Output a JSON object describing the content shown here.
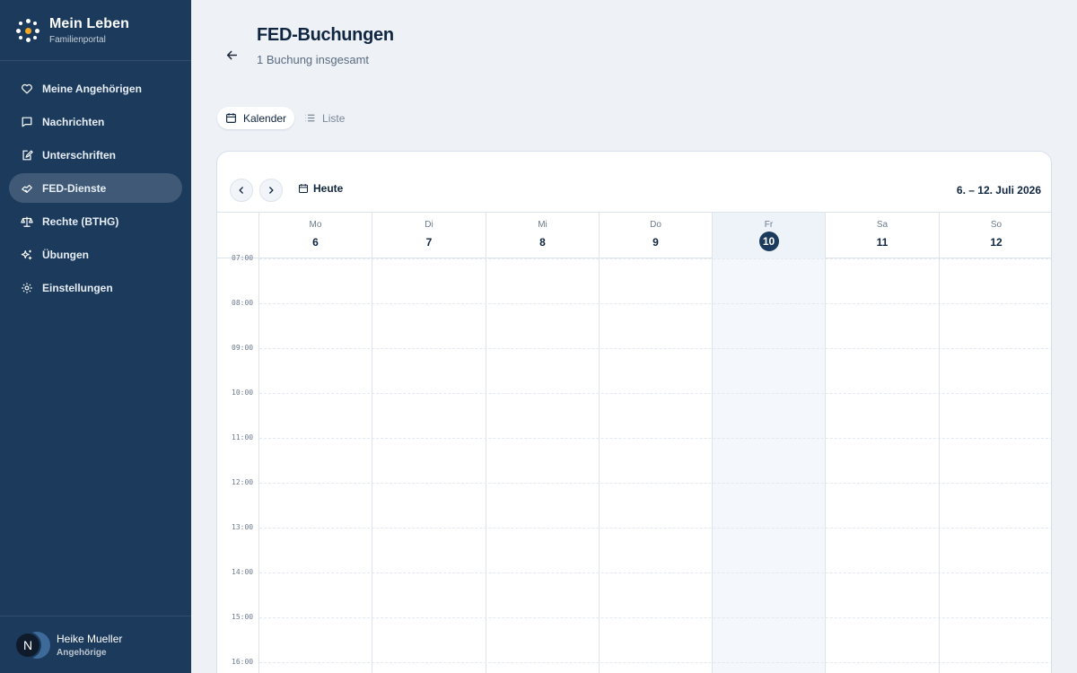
{
  "brand": {
    "name": "Mein Leben",
    "subtitle": "Familienportal"
  },
  "colors": {
    "sidebar": "#1b3a5c",
    "accent": "#1b3a5c",
    "logo_dots": [
      "#f5a623",
      "#ffffff"
    ]
  },
  "sidebar": {
    "items": [
      {
        "label": "Meine Angehörigen",
        "icon": "heart-icon"
      },
      {
        "label": "Nachrichten",
        "icon": "message-icon"
      },
      {
        "label": "Unterschriften",
        "icon": "signature-icon"
      },
      {
        "label": "FED-Dienste",
        "icon": "handshake-icon",
        "active": true
      },
      {
        "label": "Rechte (BTHG)",
        "icon": "scale-icon"
      },
      {
        "label": "Übungen",
        "icon": "sparkles-icon"
      },
      {
        "label": "Einstellungen",
        "icon": "gear-icon"
      }
    ]
  },
  "user": {
    "initial": "N",
    "name": "Heike Mueller",
    "role": "Angehörige"
  },
  "header": {
    "title": "FED-Buchungen",
    "subtitle": "1 Buchung insgesamt"
  },
  "view_toggle": {
    "calendar_label": "Kalender",
    "list_label": "Liste",
    "active": "calendar"
  },
  "calendar": {
    "today_label": "Heute",
    "range_label": "6. – 12. Juli 2026",
    "days": [
      {
        "abbr": "Mo",
        "num": "6"
      },
      {
        "abbr": "Di",
        "num": "7"
      },
      {
        "abbr": "Mi",
        "num": "8"
      },
      {
        "abbr": "Do",
        "num": "9"
      },
      {
        "abbr": "Fr",
        "num": "10",
        "today": true
      },
      {
        "abbr": "Sa",
        "num": "11"
      },
      {
        "abbr": "So",
        "num": "12"
      }
    ],
    "hours": [
      "07:00",
      "08:00",
      "09:00",
      "10:00",
      "11:00",
      "12:00",
      "13:00",
      "14:00",
      "15:00",
      "16:00"
    ]
  }
}
